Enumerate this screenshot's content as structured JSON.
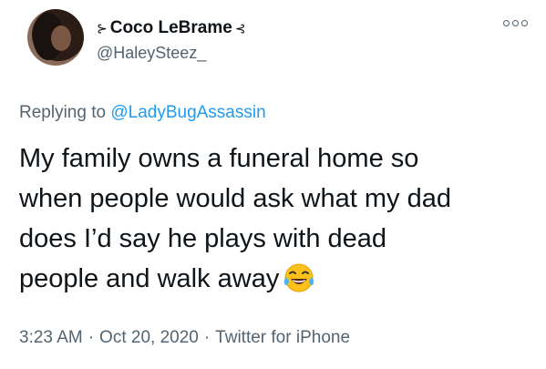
{
  "author": {
    "display_name": "Coco LeBrame",
    "deco_left": "⊱",
    "deco_right": "⊰",
    "handle": "@HaleySteez_"
  },
  "reply": {
    "prefix": "Replying to",
    "to": "@LadyBugAssassin"
  },
  "tweet": {
    "lines": [
      "My family owns a funeral home so",
      "when people would ask what my dad",
      "does I’d say he plays with dead",
      "people and walk away"
    ],
    "emoji": "face-with-tears-of-joy"
  },
  "meta": {
    "time": "3:23 AM",
    "date": "Oct 20, 2020",
    "source": "Twitter for iPhone",
    "separator": "·"
  }
}
